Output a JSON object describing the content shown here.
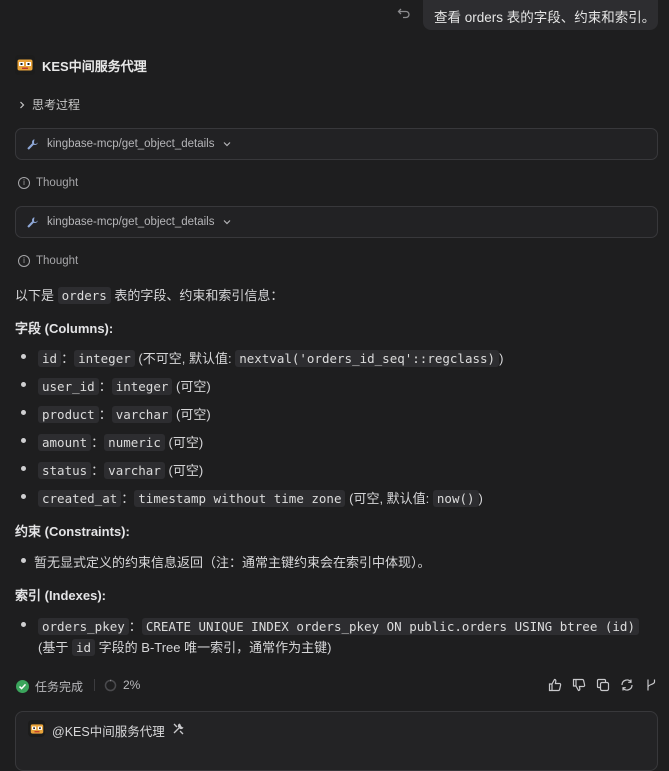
{
  "user_message": "查看 orders 表的字段、约束和索引。",
  "agent": {
    "name": "KES中间服务代理"
  },
  "thinking_toggle": "思考过程",
  "tool_calls": [
    {
      "name": "kingbase-mcp/get_object_details"
    },
    {
      "name": "kingbase-mcp/get_object_details"
    }
  ],
  "thought_label": "Thought",
  "intro": {
    "prefix": "以下是",
    "table": "orders",
    "suffix": "表的字段、约束和索引信息："
  },
  "columns_heading": "字段 (Columns):",
  "columns": [
    {
      "name": "id",
      "type": "integer",
      "note_pre": "(不可空, 默认值:",
      "default": "nextval('orders_id_seq'::regclass)",
      "note_post": ")"
    },
    {
      "name": "user_id",
      "type": "integer",
      "note_pre": "(可空)"
    },
    {
      "name": "product",
      "type": "varchar",
      "note_pre": "(可空)"
    },
    {
      "name": "amount",
      "type": "numeric",
      "note_pre": "(可空)"
    },
    {
      "name": "status",
      "type": "varchar",
      "note_pre": "(可空)"
    },
    {
      "name": "created_at",
      "type": "timestamp without time zone",
      "note_pre": "(可空, 默认值:",
      "default": "now()",
      "note_post": ")"
    }
  ],
  "separator": "：",
  "constraints_heading": "约束 (Constraints):",
  "constraints_item": "暂无显式定义的约束信息返回（注：通常主键约束会在索引中体现）。",
  "indexes_heading": "索引 (Indexes):",
  "index": {
    "name": "orders_pkey",
    "definition": "CREATE UNIQUE INDEX orders_pkey ON public.orders USING btree (id)",
    "desc_pre": "(基于",
    "desc_col": "id",
    "desc_post": "字段的 B-Tree 唯一索引，通常作为主键)"
  },
  "status": {
    "label": "任务完成",
    "progress": "2%"
  },
  "mention": {
    "label": "@KES中间服务代理"
  },
  "colors": {
    "background": "#1e1e1f",
    "success": "#3ba55c",
    "code_bg": "#2d2d30"
  }
}
